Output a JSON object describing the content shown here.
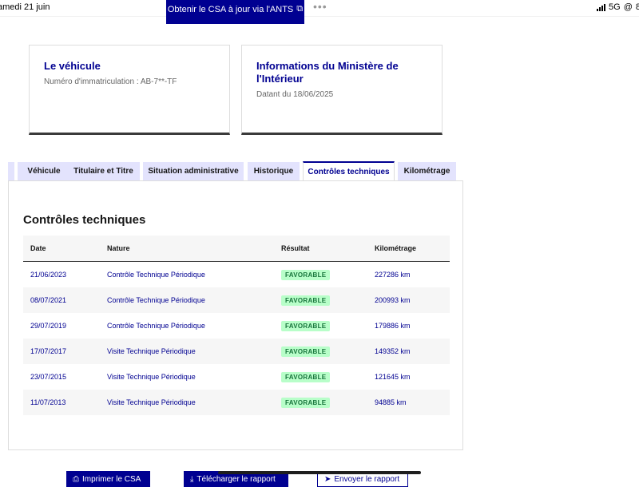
{
  "statusbar": {
    "date": "amedi 21 juin",
    "network": "5G",
    "battery": "8"
  },
  "top_button": {
    "label": "Obtenir le CSA à jour via l'ANTS"
  },
  "cards": {
    "vehicle": {
      "title": "Le véhicule",
      "text": "Numéro d'immatriculation : AB-7**-TF"
    },
    "ministry": {
      "title": "Informations du Ministère de l'Intérieur",
      "text": "Datant du 18/06/2025"
    }
  },
  "tabs": [
    {
      "label": "Véhicule"
    },
    {
      "label": "Titulaire et Titre"
    },
    {
      "label": "Situation administrative"
    },
    {
      "label": "Historique"
    },
    {
      "label": "Contrôles techniques"
    },
    {
      "label": "Kilométrage"
    }
  ],
  "active_tab": "Contrôles techniques",
  "section": {
    "title": "Contrôles techniques",
    "columns": [
      "Date",
      "Nature",
      "Résultat",
      "Kilométrage"
    ],
    "rows": [
      {
        "date": "21/06/2023",
        "nature": "Contrôle Technique Périodique",
        "result": "FAVORABLE",
        "km": "227286 km"
      },
      {
        "date": "08/07/2021",
        "nature": "Contrôle Technique Périodique",
        "result": "FAVORABLE",
        "km": "200993 km"
      },
      {
        "date": "29/07/2019",
        "nature": "Contrôle Technique Périodique",
        "result": "FAVORABLE",
        "km": "179886 km"
      },
      {
        "date": "17/07/2017",
        "nature": "Visite Technique Périodique",
        "result": "FAVORABLE",
        "km": "149352 km"
      },
      {
        "date": "23/07/2015",
        "nature": "Visite Technique Périodique",
        "result": "FAVORABLE",
        "km": "121645 km"
      },
      {
        "date": "11/07/2013",
        "nature": "Visite Technique Périodique",
        "result": "FAVORABLE",
        "km": "94885 km"
      }
    ]
  },
  "bottom_buttons": [
    {
      "label": "Imprimer le CSA"
    },
    {
      "label": "Télécharger le rapport"
    },
    {
      "label": "Envoyer le rapport"
    }
  ],
  "colors": {
    "accent": "#000091",
    "tab_bg": "#e3e3fd",
    "success_bg": "#b8fec9",
    "success_text": "#18753c"
  }
}
